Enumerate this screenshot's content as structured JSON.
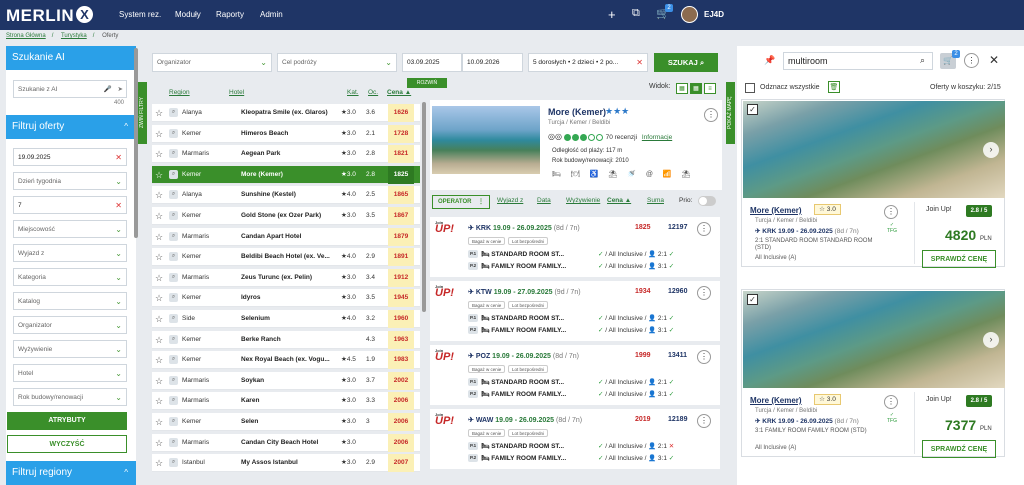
{
  "app": {
    "logo": "MERLIN",
    "logo_mark": "X",
    "user": "EJ4D",
    "cart_count": "2"
  },
  "nav": [
    "System rez.",
    "Moduły",
    "Raporty",
    "Admin"
  ],
  "breadcrumb": [
    "Strona Główna",
    "Turystyka",
    "Oferty"
  ],
  "sidebar": {
    "ai_title": "Szukanie AI",
    "ai_placeholder": "Szukanie z AI",
    "ai_counter": "400",
    "filter_title": "Filtruj oferty",
    "fields": [
      {
        "value": "19.09.2025",
        "clear": true
      },
      {
        "value": "Dzień tygodnia",
        "clear": false
      },
      {
        "value": "7",
        "clear": true
      },
      {
        "value": "Miejscowość",
        "clear": false
      },
      {
        "value": "Wyjazd z",
        "clear": false
      },
      {
        "value": "Kategoria",
        "clear": false
      },
      {
        "value": "Katalog",
        "clear": false
      },
      {
        "value": "Organizator",
        "clear": false
      },
      {
        "value": "Wyżywienie",
        "clear": false
      },
      {
        "value": "Hotel",
        "clear": false
      },
      {
        "value": "Rok budowy/renowacji",
        "clear": false
      }
    ],
    "btn_attributes": "ATRYBUTY",
    "btn_clear": "WYCZYŚĆ",
    "regions_title": "Filtruj regiony",
    "vtab": "ZWIŃ FILTRY"
  },
  "search": {
    "organizer": "Organizator",
    "destination": "Cel podróży",
    "date_from": "03.09.2025",
    "date_to": "10.09.2026",
    "people": "5 dorosłych • 2 dzieci • 2 po...",
    "button": "SZUKAJ",
    "expand": "ROZWIŃ"
  },
  "list": {
    "headers": {
      "region": "Region",
      "hotel": "Hotel",
      "kat": "Kat.",
      "oc": "Oc.",
      "cena": "Cena ▲"
    },
    "rows": [
      {
        "region": "Alanya",
        "hotel": "Kleopatra Smile (ex. Glaros)",
        "kat": "★3.0",
        "oc": "3.6",
        "price": "1626"
      },
      {
        "region": "Kemer",
        "hotel": "Himeros Beach",
        "kat": "★3.0",
        "oc": "2.1",
        "price": "1728"
      },
      {
        "region": "Marmaris",
        "hotel": "Aegean Park",
        "kat": "★3.0",
        "oc": "2.8",
        "price": "1821"
      },
      {
        "region": "Kemer",
        "hotel": "More (Kemer)",
        "kat": "★3.0",
        "oc": "2.8",
        "price": "1825",
        "selected": true
      },
      {
        "region": "Alanya",
        "hotel": "Sunshine (Kestel)",
        "kat": "★4.0",
        "oc": "2.5",
        "price": "1865"
      },
      {
        "region": "Kemer",
        "hotel": "Gold Stone (ex Ozer Park)",
        "kat": "★3.0",
        "oc": "3.5",
        "price": "1867"
      },
      {
        "region": "Marmaris",
        "hotel": "Candan Apart Hotel",
        "kat": "",
        "oc": "",
        "price": "1879"
      },
      {
        "region": "Kemer",
        "hotel": "Beldibi Beach Hotel (ex. Ve...",
        "kat": "★4.0",
        "oc": "2.9",
        "price": "1891"
      },
      {
        "region": "Marmaris",
        "hotel": "Zeus Turunc (ex. Pelin)",
        "kat": "★3.0",
        "oc": "3.4",
        "price": "1912"
      },
      {
        "region": "Kemer",
        "hotel": "Idyros",
        "kat": "★3.0",
        "oc": "3.5",
        "price": "1945"
      },
      {
        "region": "Side",
        "hotel": "Selenium",
        "kat": "★4.0",
        "oc": "3.2",
        "price": "1960"
      },
      {
        "region": "Kemer",
        "hotel": "Berke Ranch",
        "kat": "",
        "oc": "4.3",
        "price": "1963"
      },
      {
        "region": "Kemer",
        "hotel": "Nex Royal Beach (ex. Vogu...",
        "kat": "★4.5",
        "oc": "1.9",
        "price": "1983"
      },
      {
        "region": "Marmaris",
        "hotel": "Soykan",
        "kat": "★3.0",
        "oc": "3.7",
        "price": "2002"
      },
      {
        "region": "Marmaris",
        "hotel": "Karen",
        "kat": "★3.0",
        "oc": "3.3",
        "price": "2006"
      },
      {
        "region": "Kemer",
        "hotel": "Selen",
        "kat": "★3.0",
        "oc": "3",
        "price": "2006"
      },
      {
        "region": "Marmaris",
        "hotel": "Candan City Beach Hotel",
        "kat": "★3.0",
        "oc": "",
        "price": "2006"
      },
      {
        "region": "Istanbul",
        "hotel": "My Assos Istanbul",
        "kat": "★3.0",
        "oc": "2.9",
        "price": "2007"
      }
    ]
  },
  "detail": {
    "name": "More (Kemer)",
    "stars": "★★★",
    "location": "Turcja / Kemer / Beldibi",
    "reviews": "70 recenzji",
    "info": "Informacje",
    "distance": "Odległość od plaży: 117 m",
    "built": "Rok budowy/renowacji: 2010",
    "amenities": "🛏 🍽 ♿ ⛱ 🚿 @ 📶 ⛱",
    "view_label": "Widok:"
  },
  "sortbar": {
    "operator": "OPERATOR",
    "links": [
      "Wyjazd z",
      "Data",
      "Wyżywienie",
      "Cena ▲",
      "Suma"
    ],
    "prio": "Prio:"
  },
  "offers": [
    {
      "route": "KRK",
      "dates": "19.09 - 26.09.2025",
      "dur": "(8d / 7n)",
      "price": "1825",
      "code": "12197",
      "rooms": [
        {
          "tag": "P.1",
          "name": "STANDARD ROOM ST...",
          "board": "All Inclusive",
          "occ": "2:1",
          "ok": true
        },
        {
          "tag": "P.2",
          "name": "FAMILY ROOM FAMILY...",
          "board": "All Inclusive",
          "occ": "3:1",
          "ok": true
        }
      ]
    },
    {
      "route": "KTW",
      "dates": "19.09 - 27.09.2025",
      "dur": "(9d / 7n)",
      "price": "1934",
      "code": "12960",
      "rooms": [
        {
          "tag": "P.1",
          "name": "STANDARD ROOM ST...",
          "board": "All Inclusive",
          "occ": "2:1",
          "ok": true
        },
        {
          "tag": "P.2",
          "name": "FAMILY ROOM FAMILY...",
          "board": "All Inclusive",
          "occ": "3:1",
          "ok": true
        }
      ]
    },
    {
      "route": "POZ",
      "dates": "19.09 - 26.09.2025",
      "dur": "(8d / 7n)",
      "price": "1999",
      "code": "13411",
      "rooms": [
        {
          "tag": "P.1",
          "name": "STANDARD ROOM ST...",
          "board": "All Inclusive",
          "occ": "2:1",
          "ok": true
        },
        {
          "tag": "P.2",
          "name": "FAMILY ROOM FAMILY...",
          "board": "All Inclusive",
          "occ": "3:1",
          "ok": true
        }
      ]
    },
    {
      "route": "WAW",
      "dates": "19.09 - 26.09.2025",
      "dur": "(8d / 7n)",
      "price": "2019",
      "code": "12189",
      "rooms": [
        {
          "tag": "P.1",
          "name": "STANDARD ROOM ST...",
          "board": "All Inclusive",
          "occ": "2:1",
          "ok": false
        },
        {
          "tag": "P.2",
          "name": "FAMILY ROOM FAMILY...",
          "board": "All Inclusive",
          "occ": "3:1",
          "ok": true
        }
      ]
    }
  ],
  "offer_tags": {
    "baggage": "Bagaż w cenie",
    "direct": "Lot bezpośredni",
    "logo": "UP!",
    "logo_small": "Join"
  },
  "cart": {
    "search": "multiroom",
    "select_all": "Odznacz wszystkie",
    "count": "Oferty w koszyku: 2/15",
    "vtab": "POKAŻ MAPĘ",
    "cards": [
      {
        "name": "More (Kemer)",
        "rating": "☆ 3.0",
        "location": "Turcja / Kemer / Beldibi",
        "route": "KRK 19.09 - 26.09.2025",
        "dur": "(8d / 7n)",
        "room": "2:1 STANDARD ROOM STANDARD ROOM (STD)",
        "board": "All Inclusive (A)",
        "operator": "Join Up!",
        "score": "2.8 / 5",
        "price": "4820",
        "currency": "PLN",
        "button": "SPRAWDŹ CENĘ",
        "tfg": "TFG"
      },
      {
        "name": "More (Kemer)",
        "rating": "☆ 3.0",
        "location": "Turcja / Kemer / Beldibi",
        "route": "KRK 19.09 - 26.09.2025",
        "dur": "(8d / 7n)",
        "room": "3:1 FAMILY ROOM FAMILY ROOM (STD)",
        "board": "All Inclusive (A)",
        "operator": "Join Up!",
        "score": "2.8 / 5",
        "price": "7377",
        "currency": "PLN",
        "button": "SPRAWDŹ CENĘ",
        "tfg": "TFG"
      }
    ]
  }
}
